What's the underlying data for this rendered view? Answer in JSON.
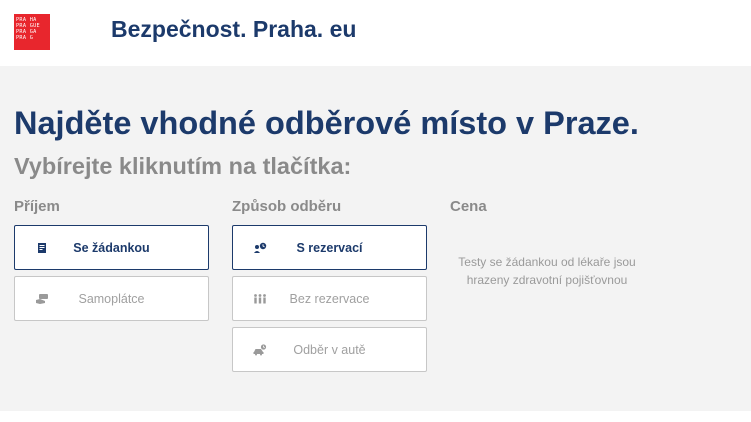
{
  "header": {
    "logo_lines": [
      "PRA HA",
      "PRA GUE",
      "PRA GA",
      "PRA G"
    ],
    "site_title": "Bezpečnost. Praha. eu"
  },
  "main": {
    "headline": "Najděte vhodné odběrové místo v Praze.",
    "subheadline": "Vybírejte kliknutím na tlačítka:"
  },
  "columns": {
    "prijem": {
      "label": "Příjem",
      "options": [
        {
          "label": "Se žádankou",
          "icon": "document-icon",
          "selected": true
        },
        {
          "label": "Samoplátce",
          "icon": "cash-hand-icon",
          "selected": false
        }
      ]
    },
    "zpusob": {
      "label": "Způsob odběru",
      "options": [
        {
          "label": "S rezervací",
          "icon": "person-clock-icon",
          "selected": true
        },
        {
          "label": "Bez rezervace",
          "icon": "queue-people-icon",
          "selected": false
        },
        {
          "label": "Odběr v autě",
          "icon": "car-clock-icon",
          "selected": false
        }
      ]
    },
    "cena": {
      "label": "Cena",
      "text": "Testy se žádankou od lékaře jsou hrazeny zdravotní pojišťovnou"
    }
  },
  "colors": {
    "brand_navy": "#1c3a6b",
    "logo_red": "#e8262d",
    "muted_gray": "#8a8a8a",
    "panel_bg": "#f3f3f3"
  }
}
